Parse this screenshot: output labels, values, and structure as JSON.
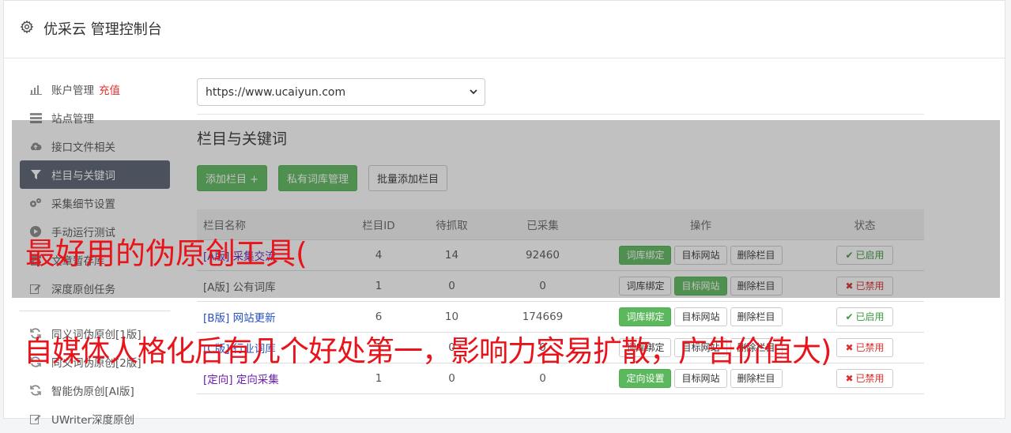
{
  "header": {
    "title": "优采云 管理控制台",
    "icon": "gear-icon"
  },
  "sidebar": {
    "items": [
      {
        "label": "账户管理",
        "extra": "充值",
        "icon": "bar-chart-icon"
      },
      {
        "label": "站点管理",
        "icon": "server-icon"
      },
      {
        "label": "接口文件相关",
        "icon": "cloud-upload-icon"
      },
      {
        "label": "栏目与关键词",
        "icon": "filter-icon",
        "active": true
      },
      {
        "label": "采集细节设置",
        "icon": "cogs-icon"
      },
      {
        "label": "手动运行测试",
        "icon": "play-icon"
      },
      {
        "label": "文章暂存库",
        "icon": "archive-icon"
      },
      {
        "label": "深度原创任务",
        "icon": "edit-icon"
      },
      {
        "label": "同义词伪原创[1版]",
        "icon": "refresh-icon"
      },
      {
        "label": "同义词伪原创[2版]",
        "icon": "refresh-icon"
      },
      {
        "label": "智能伪原创[AI版]",
        "icon": "refresh-icon"
      },
      {
        "label": "UWriter深度原创",
        "icon": "edit-icon"
      }
    ]
  },
  "main": {
    "site_select": "https://www.ucaiyun.com",
    "section_title": "栏目与关键词",
    "buttons": {
      "add_column": "添加栏目 +",
      "private_lib": "私有词库管理",
      "batch_add": "批量添加栏目"
    },
    "table": {
      "headers": {
        "name": "栏目名称",
        "id": "栏目ID",
        "pending": "待抓取",
        "collected": "已采集",
        "ops": "操作",
        "status": "状态"
      },
      "rows": [
        {
          "tag": "[A版]",
          "name": "采集交流",
          "id": "4",
          "pending": "14",
          "collected": "92460",
          "op1": "词库绑定",
          "op2": "目标网站",
          "op3": "删除栏目",
          "status": "已启用"
        },
        {
          "tag": "[A版]",
          "name": "公有词库",
          "id": "1",
          "pending": "0",
          "collected": "0",
          "op1": "词库绑定",
          "op2": "目标网站",
          "op3": "删除栏目",
          "status": "已禁用"
        },
        {
          "tag": "[B版]",
          "name": "网站更新",
          "id": "6",
          "pending": "10",
          "collected": "174669",
          "op1": "词库绑定",
          "op2": "目标网站",
          "op3": "删除栏目",
          "status": "已启用"
        },
        {
          "tag": "[C版]",
          "name": "行业词库",
          "id": "1",
          "pending": "0",
          "collected": "0",
          "op1": "词库绑定",
          "op2": "目标网站",
          "op3": "删除栏目",
          "status": "已禁用"
        },
        {
          "tag": "[定向]",
          "name": "定向采集",
          "id": "1",
          "pending": "0",
          "collected": "0",
          "op1": "定向设置",
          "op2": "目标网站",
          "op3": "删除栏目",
          "status": "已禁用"
        }
      ]
    }
  },
  "watermark": {
    "line1": "最好用的伪原创工具(",
    "line2": "自媒体人格化后有几个好处第一，影响力容易扩散，广告价值大)"
  },
  "colors": {
    "accent_green": "#5cb85c",
    "sidebar_active": "#566170",
    "watermark_red": "#e8141b"
  }
}
